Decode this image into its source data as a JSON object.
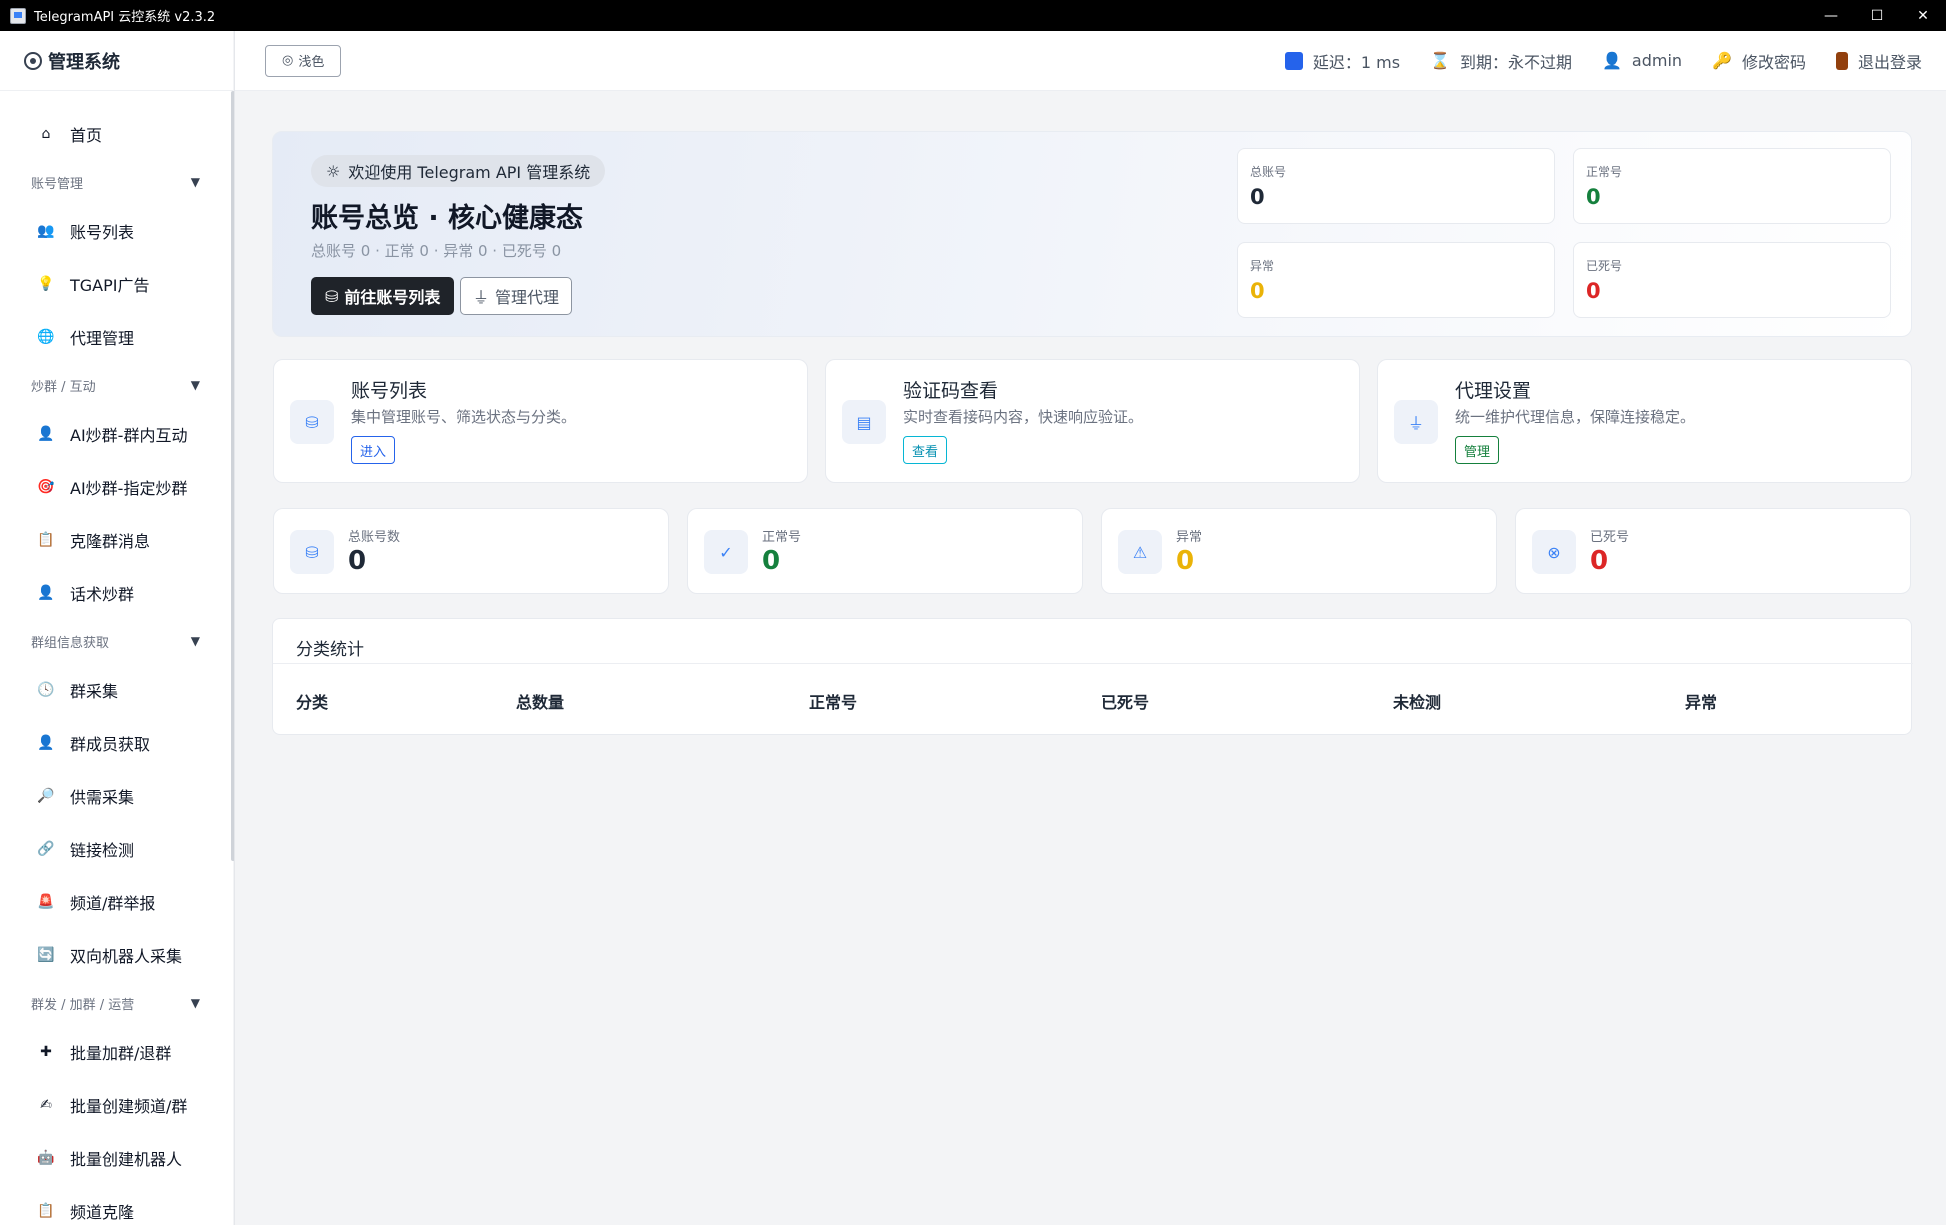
{
  "window": {
    "title": "TelegramAPI 云控系统 v2.3.2",
    "minimize": "—",
    "maximize": "☐",
    "close": "✕"
  },
  "sidebar": {
    "brand": "管理系统",
    "home": "首页",
    "groups": [
      {
        "label": "账号管理",
        "items": [
          "账号列表",
          "TGAPI广告",
          "代理管理"
        ]
      },
      {
        "label": "炒群 / 互动",
        "items": [
          "AI炒群-群内互动",
          "AI炒群-指定炒群",
          "克隆群消息",
          "话术炒群"
        ]
      },
      {
        "label": "群组信息获取",
        "items": [
          "群采集",
          "群成员获取",
          "供需采集",
          "链接检测",
          "频道/群举报",
          "双向机器人采集"
        ]
      },
      {
        "label": "群发 / 加群 / 运营",
        "items": [
          "批量加群/退群",
          "批量创建频道/群",
          "批量创建机器人",
          "频道克隆"
        ]
      }
    ]
  },
  "topbar": {
    "theme_label": "浅色",
    "latency": "延迟：1 ms",
    "expiry": "到期：永不过期",
    "user": "admin",
    "change_password": "修改密码",
    "logout": "退出登录"
  },
  "hero": {
    "pill": "欢迎使用 Telegram API 管理系统",
    "title": "账号总览 · 核心健康态",
    "subtitle": "总账号 0 · 正常 0 · 异常 0 · 已死号 0",
    "primary_button": "前往账号列表",
    "secondary_button": "管理代理",
    "mini_stats": [
      {
        "label": "总账号",
        "value": "0"
      },
      {
        "label": "正常号",
        "value": "0"
      },
      {
        "label": "异常",
        "value": "0"
      },
      {
        "label": "已死号",
        "value": "0"
      }
    ]
  },
  "features": [
    {
      "title": "账号列表",
      "desc": "集中管理账号、筛选状态与分类。",
      "button": "进入",
      "color": "#2563eb"
    },
    {
      "title": "验证码查看",
      "desc": "实时查看接码内容，快速响应验证。",
      "button": "查看",
      "color": "#0891b2"
    },
    {
      "title": "代理设置",
      "desc": "统一维护代理信息，保障连接稳定。",
      "button": "管理",
      "color": "#15803d"
    }
  ],
  "stats": [
    {
      "label": "总账号数",
      "value": "0"
    },
    {
      "label": "正常号",
      "value": "0"
    },
    {
      "label": "异常",
      "value": "0"
    },
    {
      "label": "已死号",
      "value": "0"
    }
  ],
  "category_table": {
    "title": "分类统计",
    "columns": [
      "分类",
      "总数量",
      "正常号",
      "已死号",
      "未检测",
      "异常"
    ]
  }
}
